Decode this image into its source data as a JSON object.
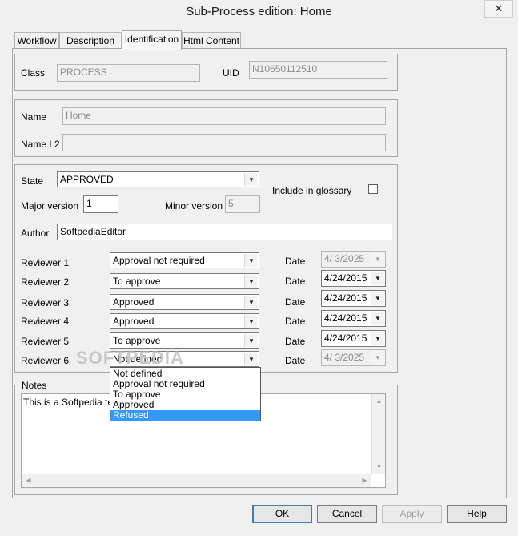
{
  "window": {
    "title": "Sub-Process edition: Home",
    "close_glyph": "✕"
  },
  "tabs": [
    {
      "label": "Workflow"
    },
    {
      "label": "Description"
    },
    {
      "label": "Identification"
    },
    {
      "label": "Html Content"
    }
  ],
  "identity": {
    "class_label": "Class",
    "class_value": "PROCESS",
    "uid_label": "UID",
    "uid_value": "N10650112510"
  },
  "names": {
    "name_label": "Name",
    "name_value": "Home",
    "name_l2_label": "Name L2",
    "name_l2_value": ""
  },
  "status": {
    "state_label": "State",
    "state_value": "APPROVED",
    "glossary_label": "Include in glossary",
    "glossary_checked": false,
    "major_label": "Major version",
    "major_value": "1",
    "minor_label": "Minor version",
    "minor_value": "5",
    "author_label": "Author",
    "author_value": "SoftpediaEditor"
  },
  "date_label": "Date",
  "reviewers": [
    {
      "label": "Reviewer 1",
      "status": "Approval not required",
      "date": "4/  3/2025",
      "date_enabled": false
    },
    {
      "label": "Reviewer 2",
      "status": "To approve",
      "date": "4/24/2015",
      "date_enabled": true
    },
    {
      "label": "Reviewer 3",
      "status": "Approved",
      "date": "4/24/2015",
      "date_enabled": true
    },
    {
      "label": "Reviewer 4",
      "status": "Approved",
      "date": "4/24/2015",
      "date_enabled": true
    },
    {
      "label": "Reviewer 5",
      "status": "To approve",
      "date": "4/24/2015",
      "date_enabled": true
    },
    {
      "label": "Reviewer 6",
      "status": "Not defined",
      "date": "4/  3/2025",
      "date_enabled": false
    }
  ],
  "dropdown": {
    "options": [
      "Not defined",
      "Approval not required",
      "To approve",
      "Approved",
      "Refused"
    ],
    "highlighted": "Refused"
  },
  "notes": {
    "label": "Notes",
    "value": "This is a Softpedia test!"
  },
  "watermark": "SOFTPEDIA",
  "buttons": {
    "ok": "OK",
    "cancel": "Cancel",
    "apply": "Apply",
    "help": "Help"
  },
  "icons": {
    "combo_arrow": "▼",
    "scroll_up": "▲",
    "scroll_down": "▼",
    "scroll_left": "◀",
    "scroll_right": "▶"
  }
}
